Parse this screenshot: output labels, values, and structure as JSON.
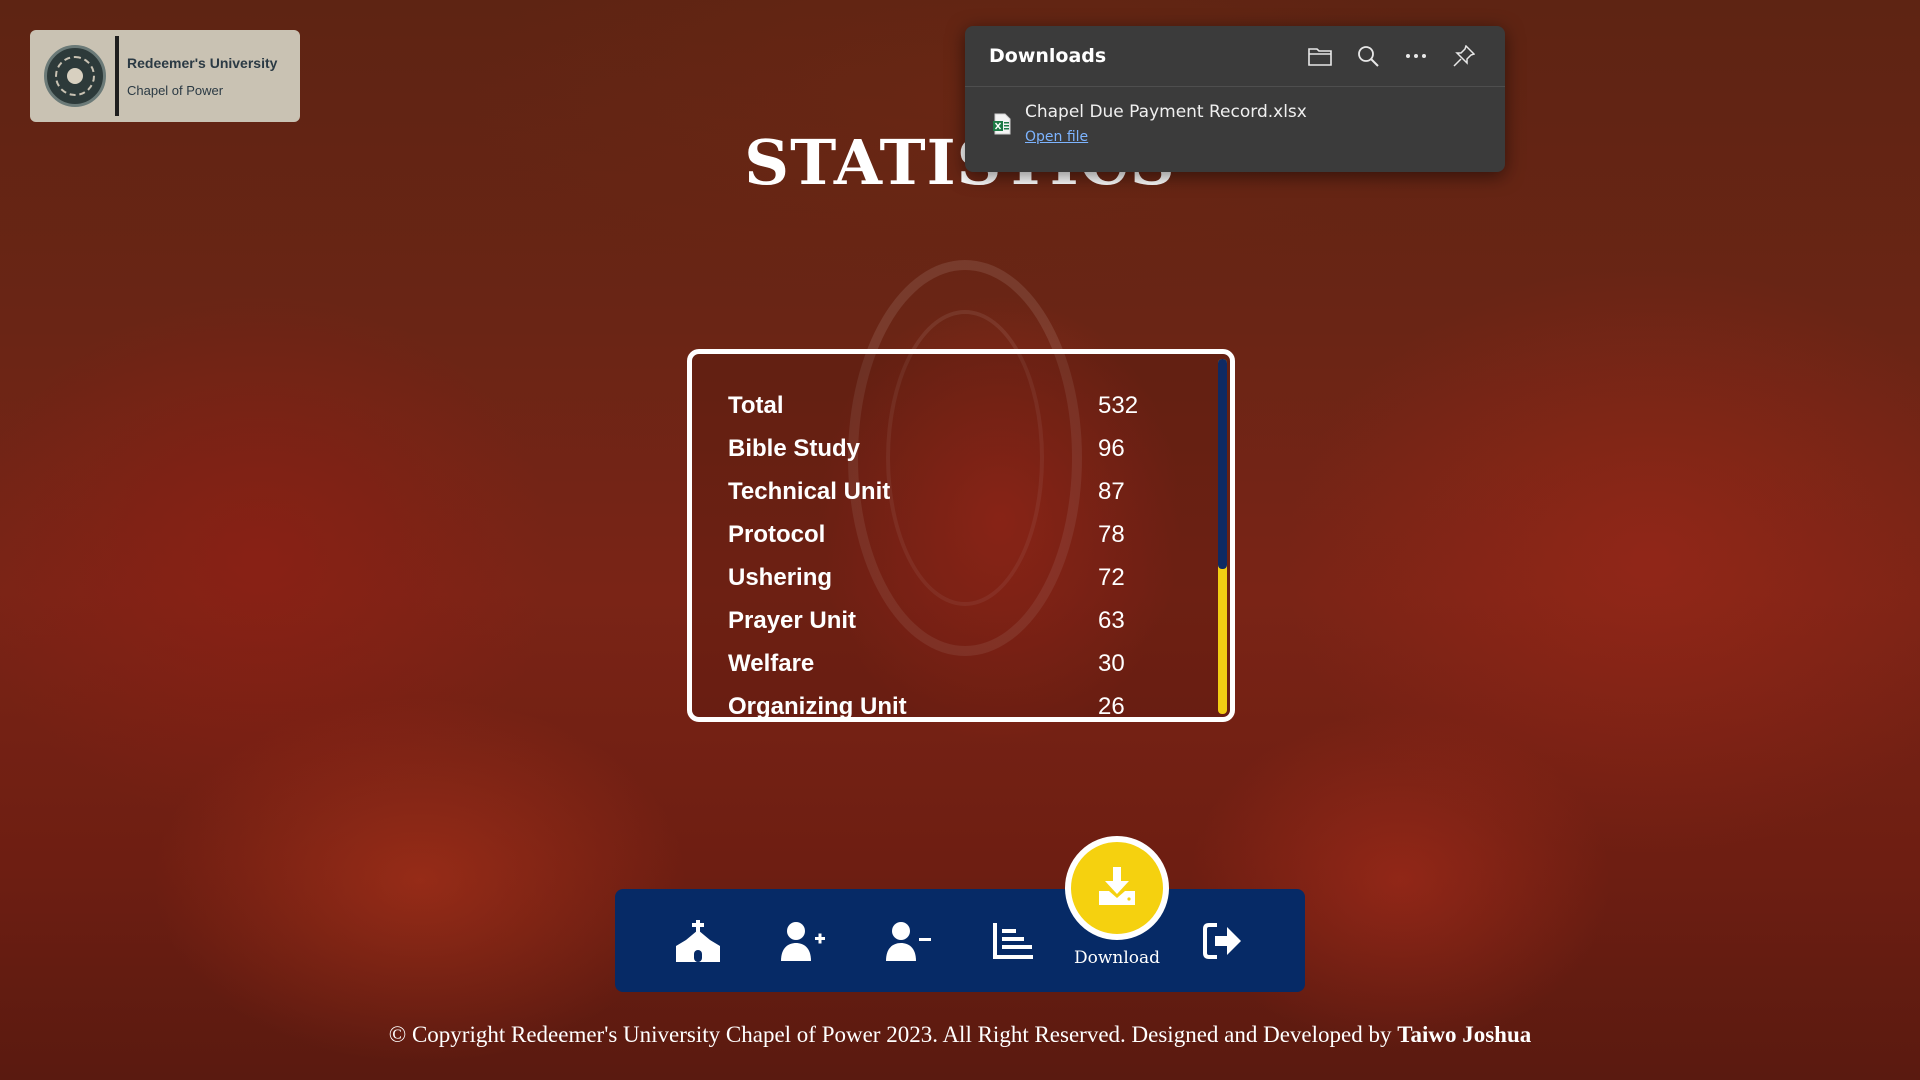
{
  "logo": {
    "name": "Redeemer's University",
    "subtitle": "Chapel of Power"
  },
  "page": {
    "title": "STATISTICS"
  },
  "stats": [
    {
      "label": "Total",
      "value": "532"
    },
    {
      "label": "Bible Study",
      "value": "96"
    },
    {
      "label": "Technical Unit",
      "value": "87"
    },
    {
      "label": "Protocol",
      "value": "78"
    },
    {
      "label": "Ushering",
      "value": "72"
    },
    {
      "label": "Prayer Unit",
      "value": "63"
    },
    {
      "label": "Welfare",
      "value": "30"
    },
    {
      "label": "Organizing Unit",
      "value": "26"
    }
  ],
  "nav": {
    "items": [
      {
        "icon": "church-icon"
      },
      {
        "icon": "user-plus-icon"
      },
      {
        "icon": "user-minus-icon"
      },
      {
        "icon": "chart-bar-icon"
      },
      {
        "icon": "download-icon",
        "label": "Download"
      },
      {
        "icon": "sign-out-icon"
      }
    ]
  },
  "footer": {
    "text": "© Copyright Redeemer's University Chapel of Power 2023. All Right Reserved. Designed and Developed by",
    "author": "Taiwo Joshua"
  },
  "downloads": {
    "title": "Downloads",
    "file_name": "Chapel Due Payment Record.xlsx",
    "open_label": "Open file"
  },
  "colors": {
    "nav_bg": "#062a66",
    "accent_yellow": "#f5d10f",
    "flyout_bg": "#3b3b3b",
    "link_blue": "#7db4ff"
  }
}
